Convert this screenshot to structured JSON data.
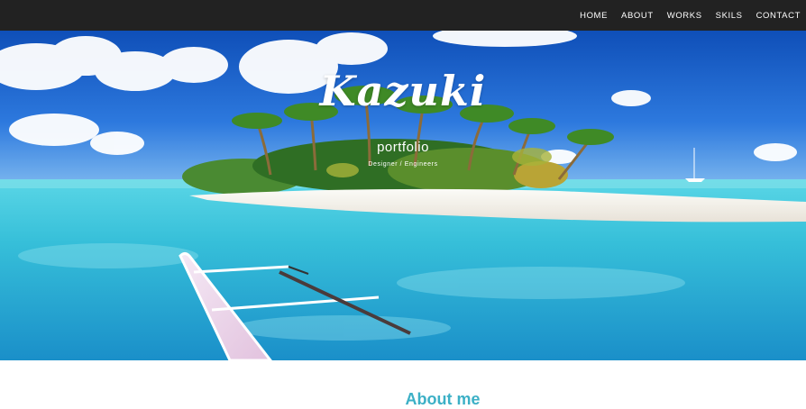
{
  "nav": {
    "items": [
      {
        "label": "HOME"
      },
      {
        "label": "ABOUT"
      },
      {
        "label": "WORKS"
      },
      {
        "label": "SKILS"
      },
      {
        "label": "CONTACT"
      }
    ]
  },
  "hero": {
    "title": "Kazuki",
    "subtitle": "portfolio",
    "tagline": "Designer / Engineers"
  },
  "about": {
    "heading": "About me"
  },
  "colors": {
    "navbar": "#222222",
    "accent": "#3cb0c6",
    "sky": "#1f5fcf",
    "sea": "#39c6dd"
  }
}
